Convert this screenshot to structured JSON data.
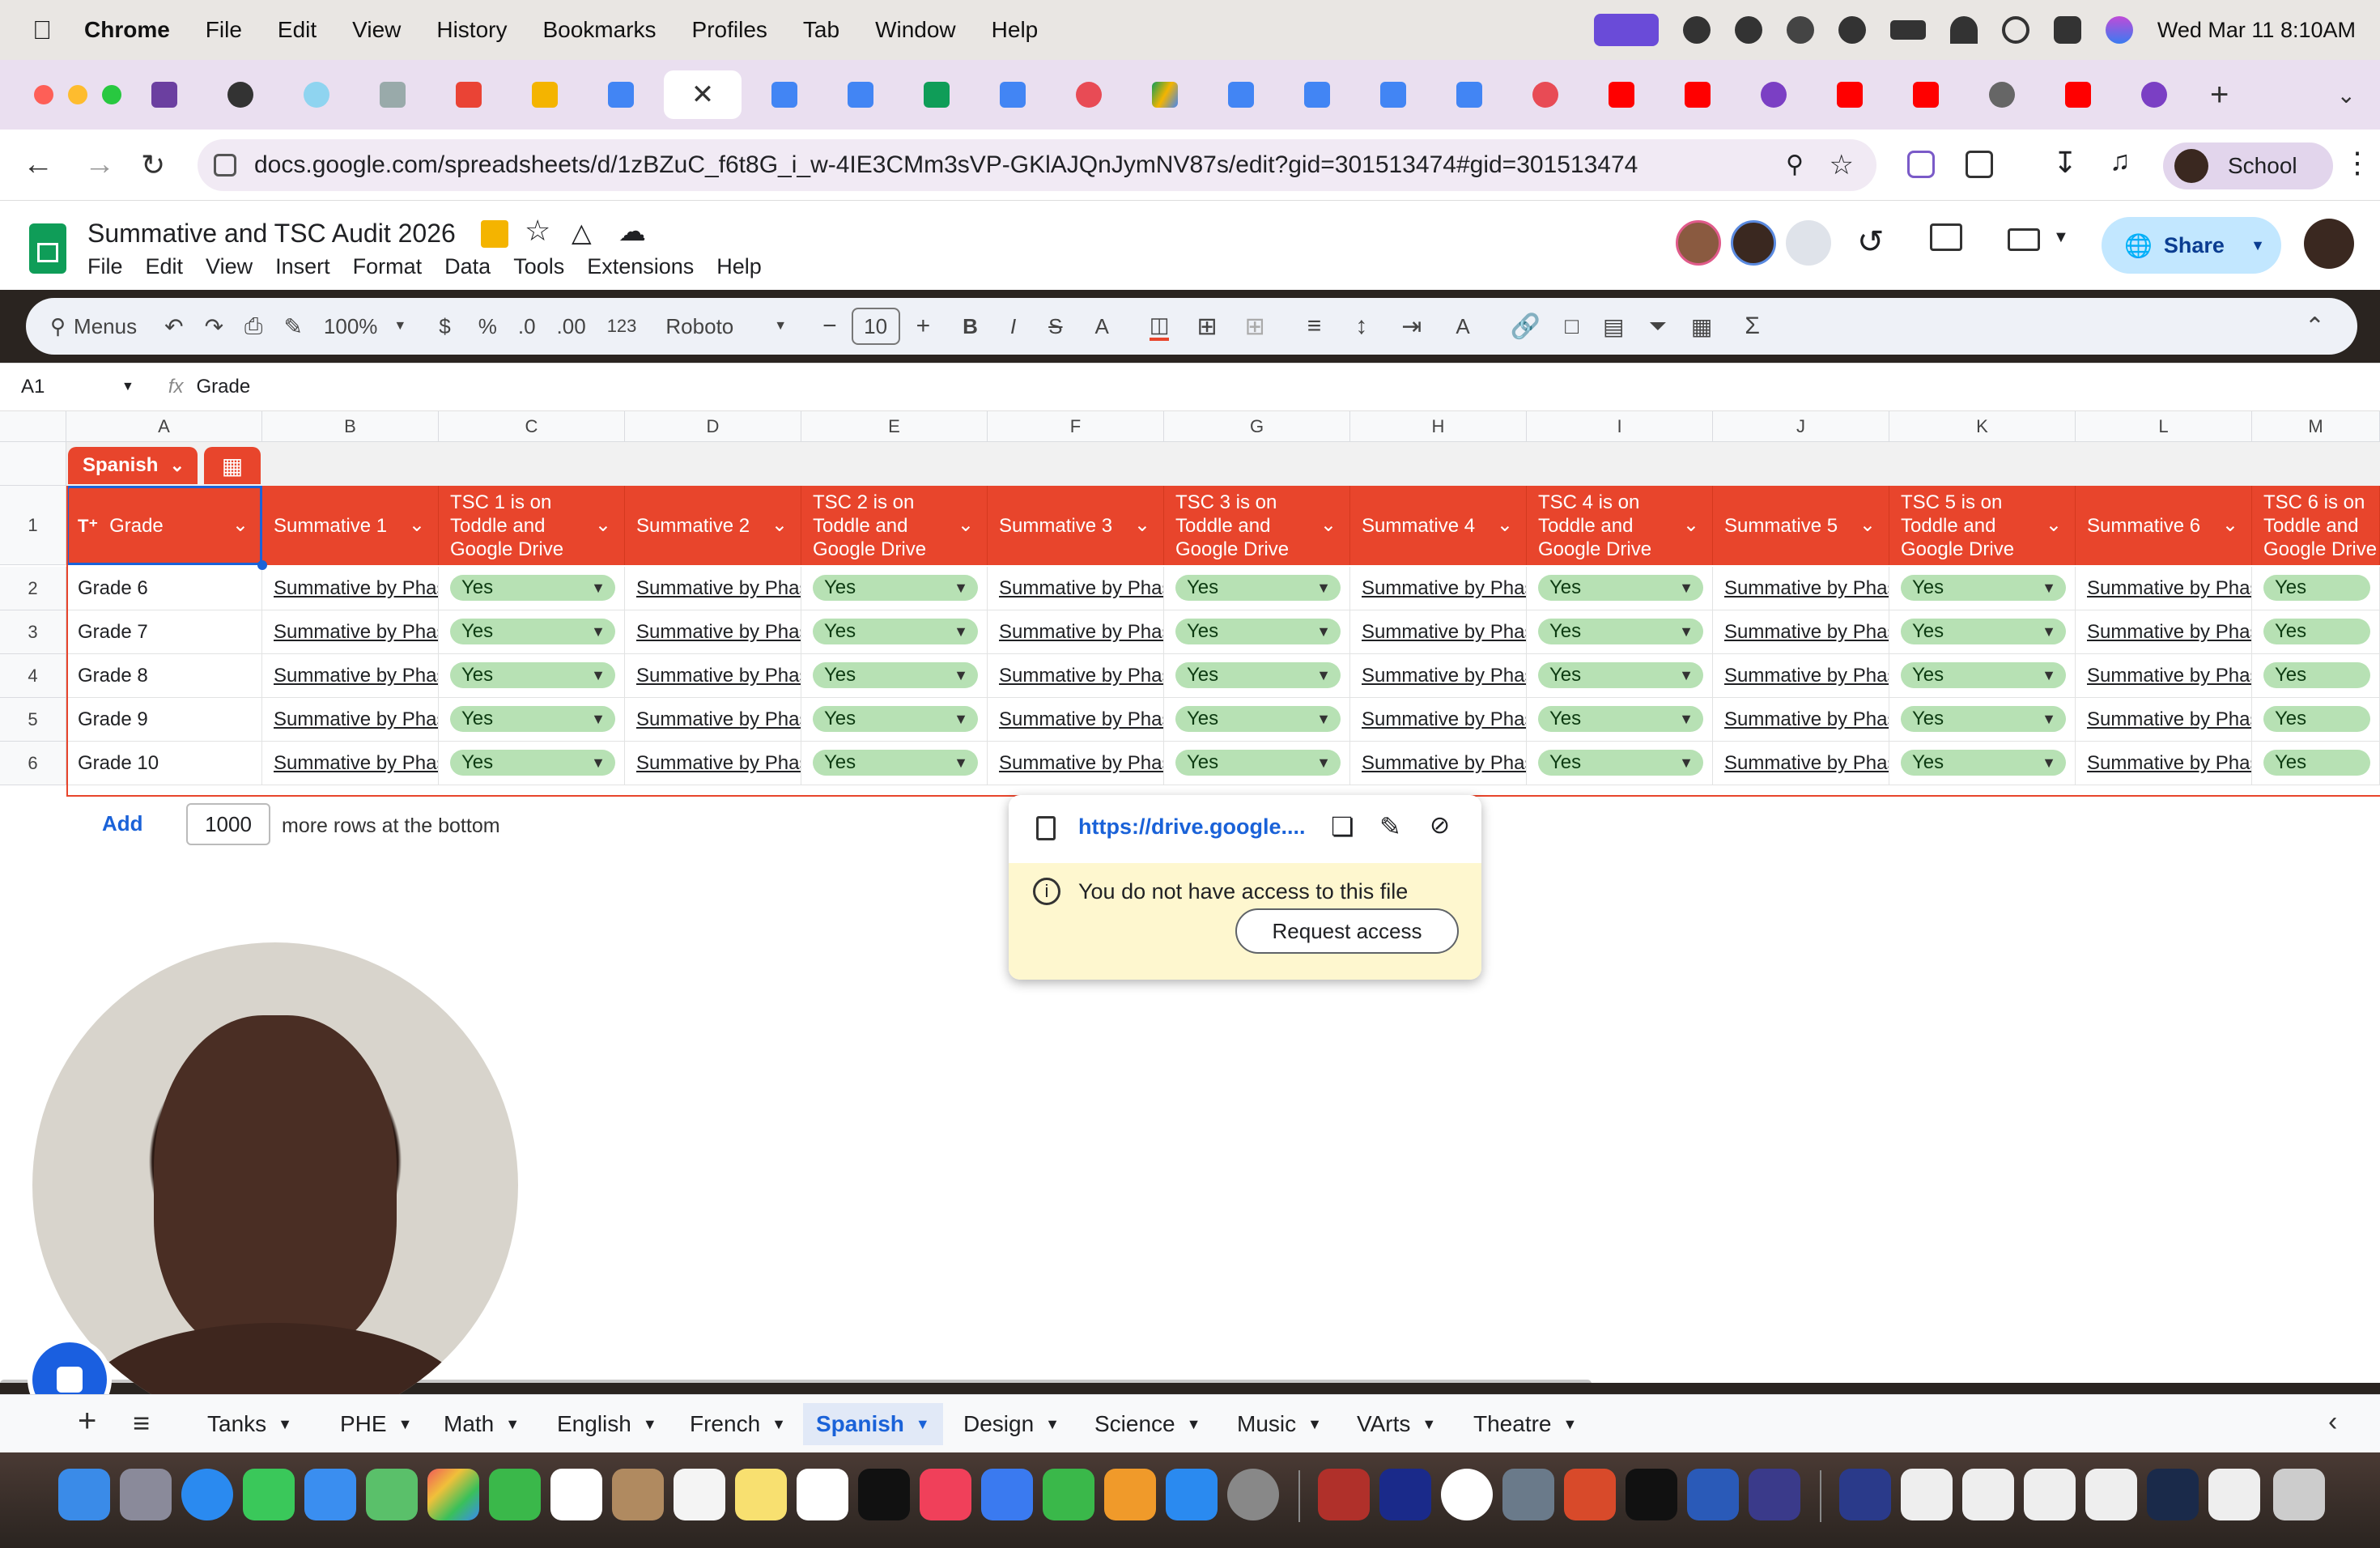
{
  "menubar": {
    "app": "Chrome",
    "items": [
      "File",
      "Edit",
      "View",
      "History",
      "Bookmarks",
      "Profiles",
      "Tab",
      "Window",
      "Help"
    ],
    "datetime": "Wed Mar 11  8:10AM"
  },
  "browser": {
    "url": "docs.google.com/spreadsheets/d/1zBZuC_f6t8G_i_w-4IE3CMm3sVP-GKlAJQnJymNV87s/edit?gid=301513474#gid=301513474",
    "profile": "School"
  },
  "sheet": {
    "title": "Summative and TSC Audit 2026",
    "menus": [
      "File",
      "Edit",
      "View",
      "Insert",
      "Format",
      "Data",
      "Tools",
      "Extensions",
      "Help"
    ],
    "share_label": "Share",
    "toolbar": {
      "menus_label": "Menus",
      "zoom": "100%",
      "currency": "$",
      "percent": "%",
      "dec_less": ".0",
      "dec_more": ".00",
      "format_num": "123",
      "font": "Roboto",
      "font_size": "10"
    },
    "name_box": "A1",
    "formula": "Grade",
    "columns": [
      "A",
      "B",
      "C",
      "D",
      "E",
      "F",
      "G",
      "H",
      "I",
      "J",
      "K",
      "L",
      "M"
    ],
    "table_name": "Spanish",
    "header_labels": [
      "Grade",
      "Summative 1",
      "TSC 1 is on Toddle and Google Drive",
      "Summative 2",
      "TSC 2 is on Toddle and Google Drive",
      "Summative 3",
      "TSC 3 is on Toddle and Google Drive",
      "Summative 4",
      "TSC 4 is on Toddle and Google Drive",
      "Summative 5",
      "TSC 5 is on Toddle and Google Drive",
      "Summative 6",
      "TSC 6 is on Toddle and Google Drive"
    ],
    "row_numbers": [
      "1",
      "2",
      "3",
      "4",
      "5",
      "6"
    ],
    "grades": [
      "Grade 6",
      "Grade 7",
      "Grade 8",
      "Grade 9",
      "Grade 10"
    ],
    "summative_text": "Summative by Phas",
    "tsc_value": "Yes",
    "add_rows": {
      "button": "Add",
      "count": "1000",
      "suffix": "more rows at the bottom"
    },
    "tabs": [
      "Tanks",
      "PHE",
      "Math",
      "English",
      "French",
      "Spanish",
      "Design",
      "Science",
      "Music",
      "VArts",
      "Theatre"
    ],
    "active_tab": "Spanish"
  },
  "popup": {
    "link": "https://drive.google....",
    "message": "You do not have access to this file",
    "button": "Request access"
  },
  "colors": {
    "header_red": "#e8452c",
    "chip_green": "#b7e1b4",
    "popup_yellow": "#fef7cf",
    "accent_blue": "#1a62d8"
  }
}
